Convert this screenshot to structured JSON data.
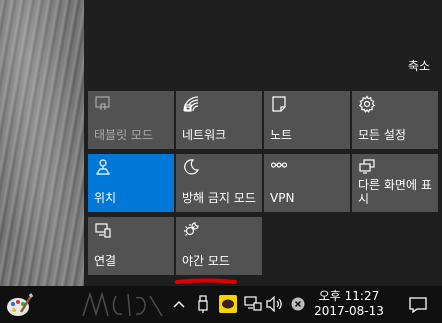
{
  "action_center": {
    "collapse_label": "축소",
    "tiles": [
      {
        "label": "태블릿 모드",
        "icon": "tablet-mode-icon",
        "state": "disabled"
      },
      {
        "label": "네트워크",
        "icon": "network-icon",
        "state": "normal"
      },
      {
        "label": "노트",
        "icon": "note-icon",
        "state": "normal"
      },
      {
        "label": "모든 설정",
        "icon": "settings-gear-icon",
        "state": "normal"
      },
      {
        "label": "위치",
        "icon": "location-icon",
        "state": "active"
      },
      {
        "label": "방해 금지 모드",
        "icon": "moon-icon",
        "state": "normal"
      },
      {
        "label": "VPN",
        "icon": "vpn-icon",
        "state": "normal"
      },
      {
        "label": "다른 화면에 표시",
        "icon": "project-icon",
        "state": "normal"
      },
      {
        "label": "연결",
        "icon": "connect-icon",
        "state": "normal"
      },
      {
        "label": "야간 모드",
        "icon": "night-light-icon",
        "state": "normal"
      }
    ]
  },
  "taskbar": {
    "clock": {
      "time": "오후 11:27",
      "date": "2017-08-13"
    },
    "tray_icons": [
      "chevron-up-icon",
      "usb-icon",
      "kakaotalk-icon",
      "network-wired-icon",
      "volume-icon",
      "close-circle-icon"
    ]
  },
  "colors": {
    "panel_bg": "#1f1f1f",
    "tile_bg": "#525252",
    "accent": "#0078d7",
    "taskbar_bg": "#101010",
    "annotation_red": "#e00000"
  }
}
